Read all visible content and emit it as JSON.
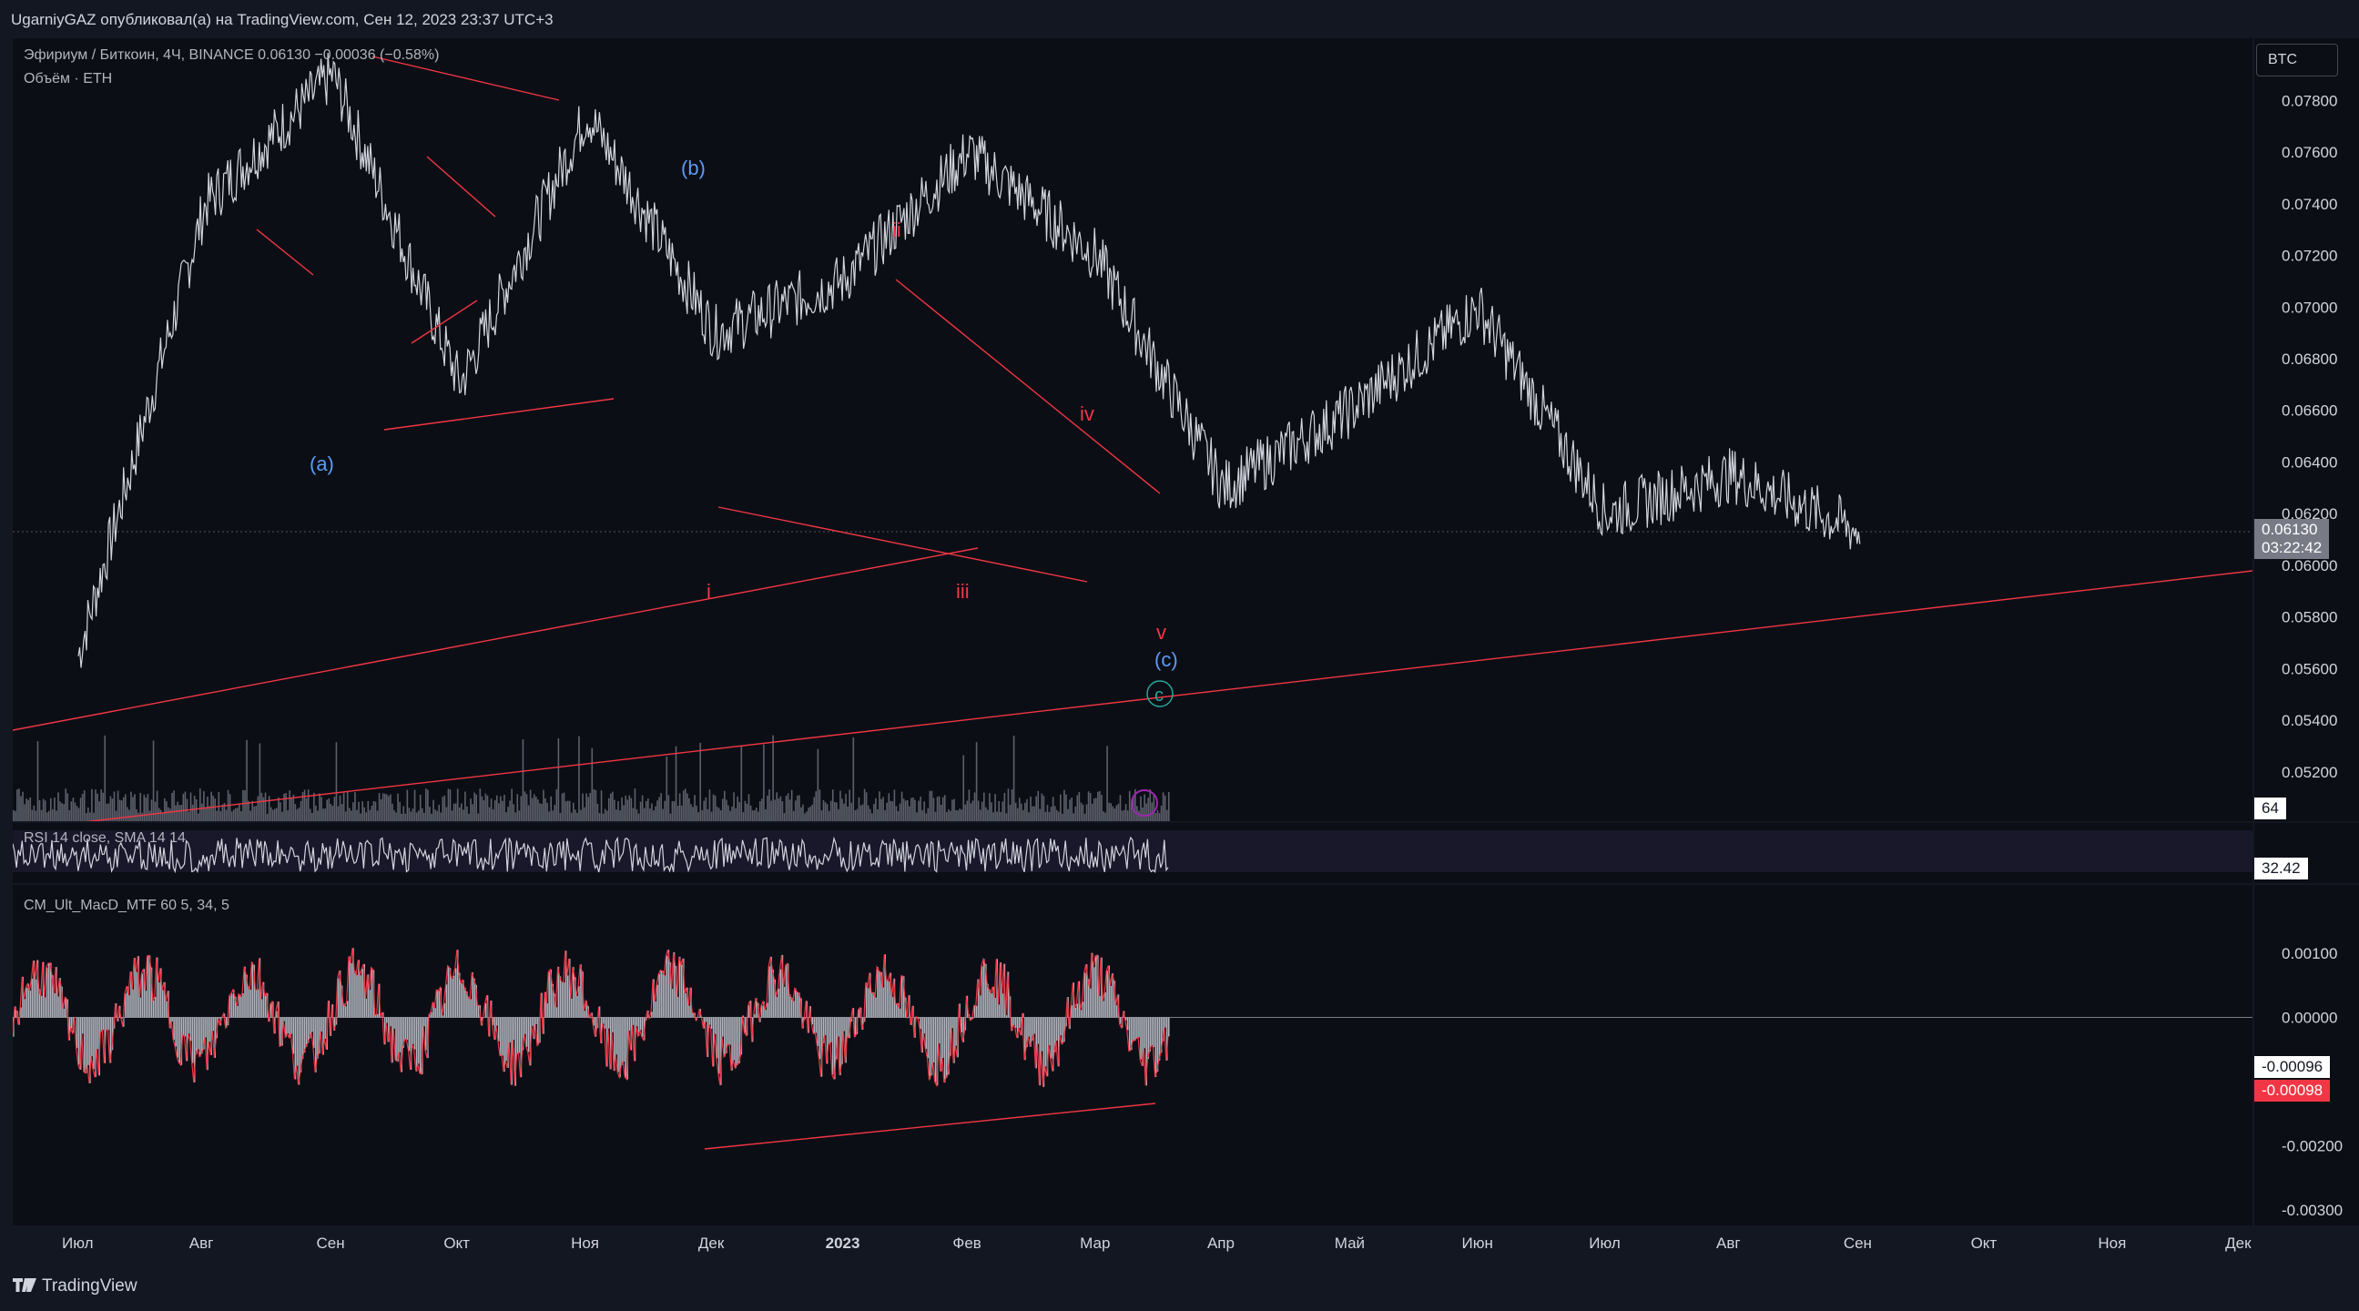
{
  "header": {
    "published_by": "UgarniyGAZ опубликовал(а) на TradingView.com, Сен 12, 2023 23:37 UTC+3"
  },
  "chart": {
    "symbol_line": "Эфириум / Биткоин, 4Ч, BINANCE  0.06130  −0.00036 (−0.58%)",
    "volume_label": "Объём · ETH",
    "currency_button": "BTC",
    "rsi_label": "RSI 14 close, SMA 14 14",
    "macd_label": "CM_Ult_MacD_MTF 60 5, 34, 5",
    "last_price": "0.06130",
    "countdown": "03:22:42",
    "volume_tag": "64",
    "rsi_value": "32.42",
    "macd_value_1": "-0.00096",
    "macd_value_2": "-0.00098",
    "price_ticks": [
      "0.07800",
      "0.07600",
      "0.07400",
      "0.07200",
      "0.07000",
      "0.06800",
      "0.06600",
      "0.06400",
      "0.06200",
      "0.06000",
      "0.05800",
      "0.05600",
      "0.05400",
      "0.05200"
    ],
    "macd_ticks": [
      "0.00100",
      "0.00000",
      "-0.00200",
      "-0.00300"
    ],
    "time_ticks": [
      "Июл",
      "Авг",
      "Сен",
      "Окт",
      "Ноя",
      "Дек",
      "2023",
      "Фев",
      "Мар",
      "Апр",
      "Май",
      "Июн",
      "Июл",
      "Авг",
      "Сен",
      "Окт",
      "Ноя",
      "Дек"
    ],
    "wave_labels": {
      "a": "(a)",
      "b": "(b)",
      "c": "(c)",
      "c2": "c",
      "i": "i",
      "ii": "ii",
      "iii": "iii",
      "iv": "iv",
      "v": "v"
    },
    "colors": {
      "background": "#0c0e15",
      "price_line": "#d1d4dc",
      "trendline": "#f23645",
      "wave_blue": "#5b9cf6",
      "wave_red": "#f23645",
      "wave_green": "#26a69a",
      "macd_bar": "#b2b5be",
      "macd_line": "#f23645",
      "rsi_band": "#7e57c2"
    }
  },
  "chart_data": {
    "type": "line",
    "title": "Эфириум / Биткоин, 4Ч, BINANCE",
    "x": [
      "Июл",
      "Авг",
      "Сен",
      "Окт",
      "Ноя",
      "Дек",
      "2023",
      "Фев",
      "Мар",
      "Апр",
      "Май",
      "Июн",
      "Июл",
      "Авг",
      "Сен"
    ],
    "series": [
      {
        "name": "Эфириум / Биткоин",
        "values": [
          0.0565,
          0.074,
          0.079,
          0.067,
          0.0775,
          0.069,
          0.071,
          0.076,
          0.072,
          0.063,
          0.066,
          0.07,
          0.062,
          0.0635,
          0.0613
        ]
      }
    ],
    "ylim": [
      0.0515,
      0.079
    ]
  },
  "footer": {
    "brand": "TradingView"
  }
}
